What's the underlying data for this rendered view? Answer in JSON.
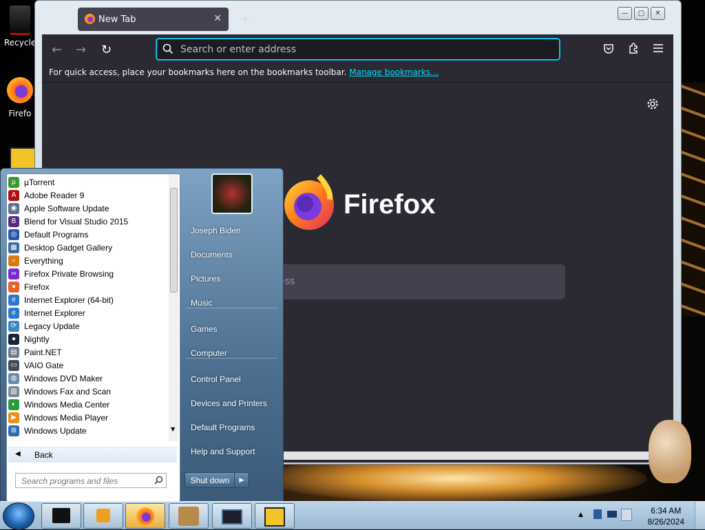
{
  "desktop": {
    "icons": [
      {
        "label": "Recycle",
        "icon": "recycle-bin-icon"
      },
      {
        "label": "Firefo",
        "icon": "firefox-icon"
      }
    ]
  },
  "firefox": {
    "tab": {
      "title": "New Tab",
      "close": "✕"
    },
    "newtab_symbol": "+",
    "window_controls": {
      "minimize": "—",
      "maximize": "▢",
      "close": "✕"
    },
    "urlbar": {
      "placeholder": "Search or enter address"
    },
    "bookmarks_bar": {
      "text": "For quick access, place your bookmarks here on the bookmarks toolbar.",
      "link": "Manage bookmarks…"
    },
    "brand": "Firefox",
    "page_search_partial": "ess"
  },
  "start_menu": {
    "programs": [
      {
        "label": "µTorrent",
        "color": "#3a9a2a",
        "glyph": "µ"
      },
      {
        "label": "Adobe Reader 9",
        "color": "#b01010",
        "glyph": "A"
      },
      {
        "label": "Apple Software Update",
        "color": "#5d6f8c",
        "glyph": "◉"
      },
      {
        "label": "Blend for Visual Studio 2015",
        "color": "#5a2a8a",
        "glyph": "B"
      },
      {
        "label": "Default Programs",
        "color": "#2a58a8",
        "glyph": "◎"
      },
      {
        "label": "Desktop Gadget Gallery",
        "color": "#3a6aa0",
        "glyph": "▦"
      },
      {
        "label": "Everything",
        "color": "#d87a10",
        "glyph": "⌕"
      },
      {
        "label": "Firefox Private Browsing",
        "color": "#7a2ac8",
        "glyph": "∞"
      },
      {
        "label": "Firefox",
        "color": "#e8602a",
        "glyph": "●"
      },
      {
        "label": "Internet Explorer (64-bit)",
        "color": "#2a7ad0",
        "glyph": "e"
      },
      {
        "label": "Internet Explorer",
        "color": "#2a7ad0",
        "glyph": "e"
      },
      {
        "label": "Legacy Update",
        "color": "#3a8ac0",
        "glyph": "⟳"
      },
      {
        "label": "Nightly",
        "color": "#1a2438",
        "glyph": "●"
      },
      {
        "label": "Paint.NET",
        "color": "#6a7a8a",
        "glyph": "▤"
      },
      {
        "label": "VAIO Gate",
        "color": "#404a58",
        "glyph": "▭"
      },
      {
        "label": "Windows DVD Maker",
        "color": "#6a8aaa",
        "glyph": "◍"
      },
      {
        "label": "Windows Fax and Scan",
        "color": "#7a8a9a",
        "glyph": "▥"
      },
      {
        "label": "Windows Media Center",
        "color": "#2a9a3a",
        "glyph": "◐"
      },
      {
        "label": "Windows Media Player",
        "color": "#e8901a",
        "glyph": "▶"
      },
      {
        "label": "Windows Update",
        "color": "#2a6ab0",
        "glyph": "⊞"
      }
    ],
    "back_label": "Back",
    "search_placeholder": "Search programs and files",
    "right_items": [
      "Joseph Biden",
      "Documents",
      "Pictures",
      "Music",
      "Games",
      "Computer",
      "Control Panel",
      "Devices and Printers",
      "Default Programs",
      "Help and Support"
    ],
    "shutdown_label": "Shut down"
  },
  "taskbar": {
    "time": "6:34 AM",
    "date": "8/26/2024",
    "pinned": [
      "terminal-app",
      "media-player",
      "firefox",
      "box-app",
      "monitor-app",
      "de-app"
    ]
  }
}
